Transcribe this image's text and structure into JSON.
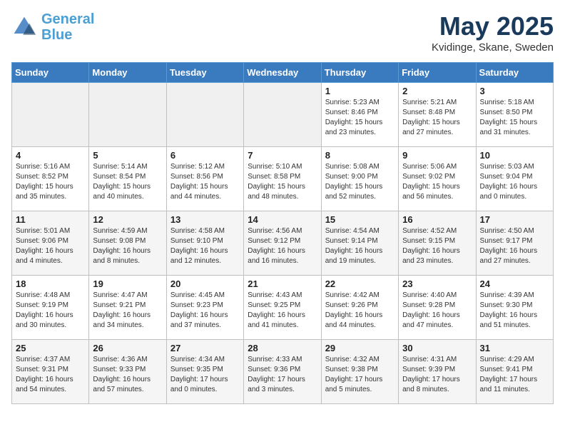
{
  "logo": {
    "line1": "General",
    "line2": "Blue"
  },
  "title": "May 2025",
  "location": "Kvidinge, Skane, Sweden",
  "days_of_week": [
    "Sunday",
    "Monday",
    "Tuesday",
    "Wednesday",
    "Thursday",
    "Friday",
    "Saturday"
  ],
  "weeks": [
    [
      {
        "day": "",
        "empty": true
      },
      {
        "day": "",
        "empty": true
      },
      {
        "day": "",
        "empty": true
      },
      {
        "day": "",
        "empty": true
      },
      {
        "day": "1",
        "lines": [
          "Sunrise: 5:23 AM",
          "Sunset: 8:46 PM",
          "Daylight: 15 hours",
          "and 23 minutes."
        ]
      },
      {
        "day": "2",
        "lines": [
          "Sunrise: 5:21 AM",
          "Sunset: 8:48 PM",
          "Daylight: 15 hours",
          "and 27 minutes."
        ]
      },
      {
        "day": "3",
        "lines": [
          "Sunrise: 5:18 AM",
          "Sunset: 8:50 PM",
          "Daylight: 15 hours",
          "and 31 minutes."
        ]
      }
    ],
    [
      {
        "day": "4",
        "lines": [
          "Sunrise: 5:16 AM",
          "Sunset: 8:52 PM",
          "Daylight: 15 hours",
          "and 35 minutes."
        ]
      },
      {
        "day": "5",
        "lines": [
          "Sunrise: 5:14 AM",
          "Sunset: 8:54 PM",
          "Daylight: 15 hours",
          "and 40 minutes."
        ]
      },
      {
        "day": "6",
        "lines": [
          "Sunrise: 5:12 AM",
          "Sunset: 8:56 PM",
          "Daylight: 15 hours",
          "and 44 minutes."
        ]
      },
      {
        "day": "7",
        "lines": [
          "Sunrise: 5:10 AM",
          "Sunset: 8:58 PM",
          "Daylight: 15 hours",
          "and 48 minutes."
        ]
      },
      {
        "day": "8",
        "lines": [
          "Sunrise: 5:08 AM",
          "Sunset: 9:00 PM",
          "Daylight: 15 hours",
          "and 52 minutes."
        ]
      },
      {
        "day": "9",
        "lines": [
          "Sunrise: 5:06 AM",
          "Sunset: 9:02 PM",
          "Daylight: 15 hours",
          "and 56 minutes."
        ]
      },
      {
        "day": "10",
        "lines": [
          "Sunrise: 5:03 AM",
          "Sunset: 9:04 PM",
          "Daylight: 16 hours",
          "and 0 minutes."
        ]
      }
    ],
    [
      {
        "day": "11",
        "lines": [
          "Sunrise: 5:01 AM",
          "Sunset: 9:06 PM",
          "Daylight: 16 hours",
          "and 4 minutes."
        ]
      },
      {
        "day": "12",
        "lines": [
          "Sunrise: 4:59 AM",
          "Sunset: 9:08 PM",
          "Daylight: 16 hours",
          "and 8 minutes."
        ]
      },
      {
        "day": "13",
        "lines": [
          "Sunrise: 4:58 AM",
          "Sunset: 9:10 PM",
          "Daylight: 16 hours",
          "and 12 minutes."
        ]
      },
      {
        "day": "14",
        "lines": [
          "Sunrise: 4:56 AM",
          "Sunset: 9:12 PM",
          "Daylight: 16 hours",
          "and 16 minutes."
        ]
      },
      {
        "day": "15",
        "lines": [
          "Sunrise: 4:54 AM",
          "Sunset: 9:14 PM",
          "Daylight: 16 hours",
          "and 19 minutes."
        ]
      },
      {
        "day": "16",
        "lines": [
          "Sunrise: 4:52 AM",
          "Sunset: 9:15 PM",
          "Daylight: 16 hours",
          "and 23 minutes."
        ]
      },
      {
        "day": "17",
        "lines": [
          "Sunrise: 4:50 AM",
          "Sunset: 9:17 PM",
          "Daylight: 16 hours",
          "and 27 minutes."
        ]
      }
    ],
    [
      {
        "day": "18",
        "lines": [
          "Sunrise: 4:48 AM",
          "Sunset: 9:19 PM",
          "Daylight: 16 hours",
          "and 30 minutes."
        ]
      },
      {
        "day": "19",
        "lines": [
          "Sunrise: 4:47 AM",
          "Sunset: 9:21 PM",
          "Daylight: 16 hours",
          "and 34 minutes."
        ]
      },
      {
        "day": "20",
        "lines": [
          "Sunrise: 4:45 AM",
          "Sunset: 9:23 PM",
          "Daylight: 16 hours",
          "and 37 minutes."
        ]
      },
      {
        "day": "21",
        "lines": [
          "Sunrise: 4:43 AM",
          "Sunset: 9:25 PM",
          "Daylight: 16 hours",
          "and 41 minutes."
        ]
      },
      {
        "day": "22",
        "lines": [
          "Sunrise: 4:42 AM",
          "Sunset: 9:26 PM",
          "Daylight: 16 hours",
          "and 44 minutes."
        ]
      },
      {
        "day": "23",
        "lines": [
          "Sunrise: 4:40 AM",
          "Sunset: 9:28 PM",
          "Daylight: 16 hours",
          "and 47 minutes."
        ]
      },
      {
        "day": "24",
        "lines": [
          "Sunrise: 4:39 AM",
          "Sunset: 9:30 PM",
          "Daylight: 16 hours",
          "and 51 minutes."
        ]
      }
    ],
    [
      {
        "day": "25",
        "lines": [
          "Sunrise: 4:37 AM",
          "Sunset: 9:31 PM",
          "Daylight: 16 hours",
          "and 54 minutes."
        ]
      },
      {
        "day": "26",
        "lines": [
          "Sunrise: 4:36 AM",
          "Sunset: 9:33 PM",
          "Daylight: 16 hours",
          "and 57 minutes."
        ]
      },
      {
        "day": "27",
        "lines": [
          "Sunrise: 4:34 AM",
          "Sunset: 9:35 PM",
          "Daylight: 17 hours",
          "and 0 minutes."
        ]
      },
      {
        "day": "28",
        "lines": [
          "Sunrise: 4:33 AM",
          "Sunset: 9:36 PM",
          "Daylight: 17 hours",
          "and 3 minutes."
        ]
      },
      {
        "day": "29",
        "lines": [
          "Sunrise: 4:32 AM",
          "Sunset: 9:38 PM",
          "Daylight: 17 hours",
          "and 5 minutes."
        ]
      },
      {
        "day": "30",
        "lines": [
          "Sunrise: 4:31 AM",
          "Sunset: 9:39 PM",
          "Daylight: 17 hours",
          "and 8 minutes."
        ]
      },
      {
        "day": "31",
        "lines": [
          "Sunrise: 4:29 AM",
          "Sunset: 9:41 PM",
          "Daylight: 17 hours",
          "and 11 minutes."
        ]
      }
    ]
  ]
}
